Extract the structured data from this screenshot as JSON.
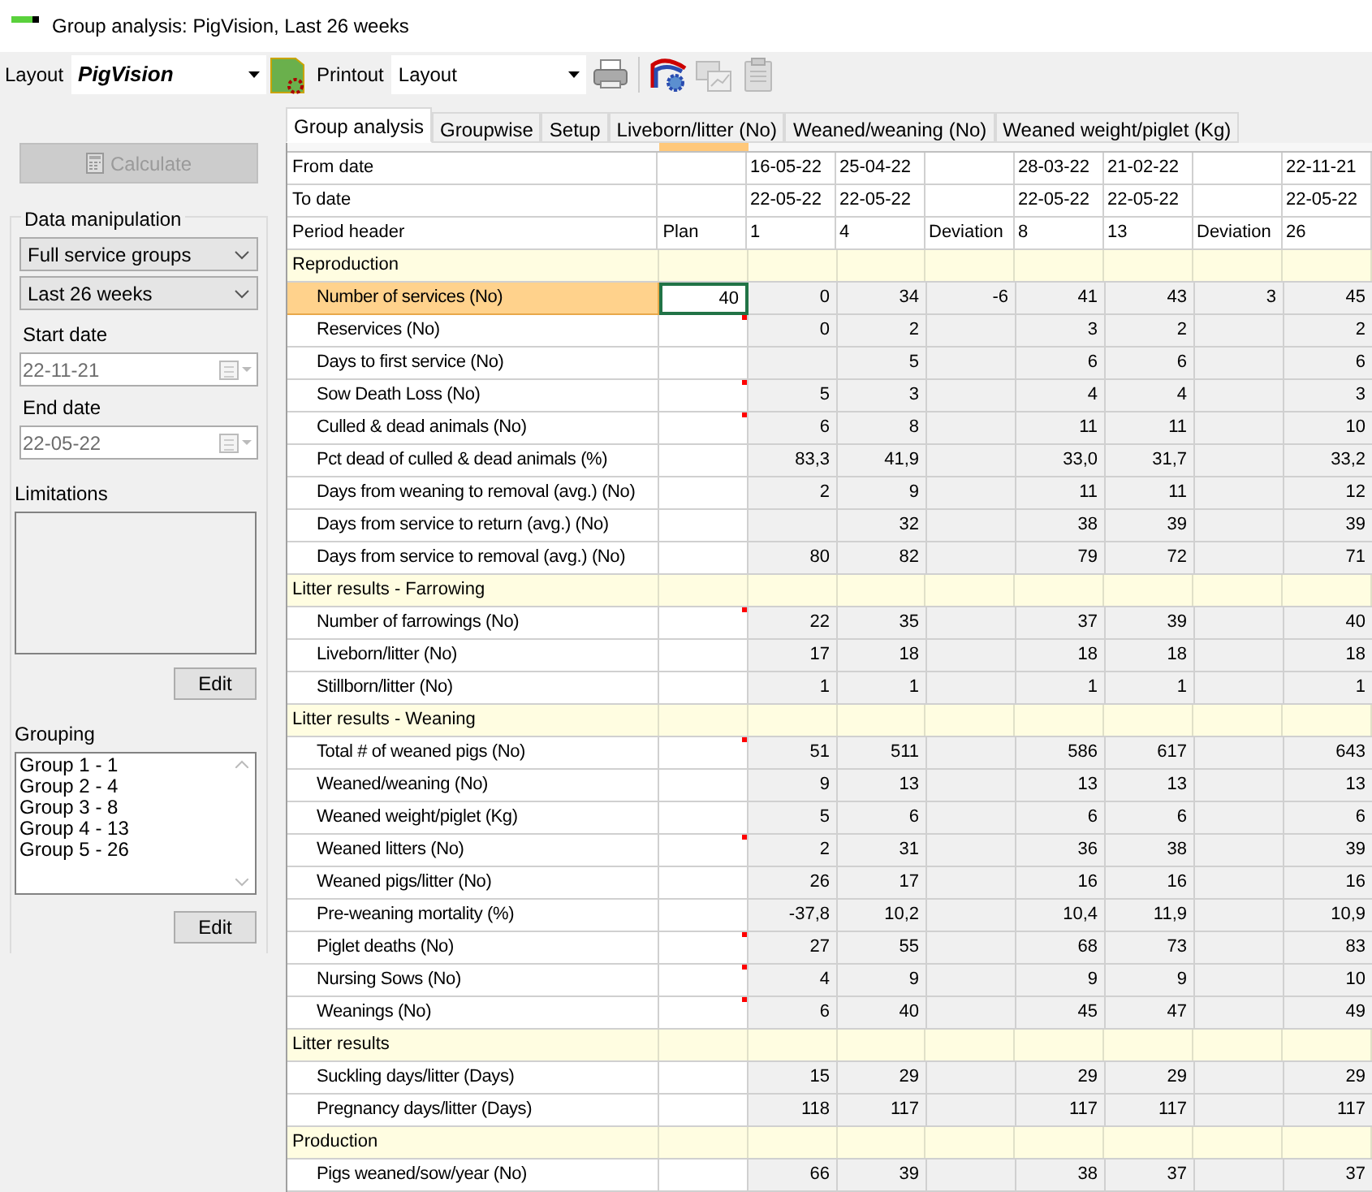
{
  "window": {
    "title": "Group analysis: PigVision, Last 26 weeks"
  },
  "toolbar": {
    "layout_label": "Layout",
    "layout_value": "PigVision",
    "printout_label": "Printout",
    "printout_value": "Layout"
  },
  "sidebar": {
    "calculate": {
      "label": "Calculate",
      "disabled": true
    },
    "data_manipulation": {
      "title": "Data manipulation",
      "selects": [
        "Full service groups",
        "Last 26 weeks"
      ],
      "start_date": {
        "label": "Start date",
        "value": "22-11-21"
      },
      "end_date": {
        "label": "End date",
        "value": "22-05-22"
      }
    },
    "limitations": {
      "label": "Limitations",
      "edit": "Edit"
    },
    "grouping": {
      "label": "Grouping",
      "items": [
        "Group 1 - 1",
        "Group 2 - 4",
        "Group 3 - 8",
        "Group 4 - 13",
        "Group 5 - 26"
      ],
      "edit": "Edit"
    }
  },
  "tabs": [
    {
      "label": "Group analysis",
      "selected": true
    },
    {
      "label": "Groupwise",
      "selected": false
    },
    {
      "label": "Setup",
      "selected": false
    },
    {
      "label": "Liveborn/litter (No)",
      "selected": false
    },
    {
      "label": "Weaned/weaning (No)",
      "selected": false
    },
    {
      "label": "Weaned weight/piglet (Kg)",
      "selected": false
    }
  ],
  "table": {
    "rows": [
      {
        "kind": "info",
        "label": "From date",
        "cells": {
          "column_1": "16-05-22",
          "column_2": "25-04-22",
          "column_4": "28-03-22",
          "column_5": "21-02-22",
          "column_7": "22-11-21"
        }
      },
      {
        "kind": "info",
        "label": "To date",
        "cells": {
          "column_1": "22-05-22",
          "column_2": "22-05-22",
          "column_4": "22-05-22",
          "column_5": "22-05-22",
          "column_7": "22-05-22"
        }
      },
      {
        "kind": "info",
        "label": "Period header",
        "plan": "Plan",
        "cells": {
          "column_1": "1",
          "column_2": "4",
          "column_3": "Deviation",
          "column_4": "8",
          "column_5": "13",
          "column_6": "Deviation",
          "column_7": "26"
        }
      },
      {
        "kind": "section",
        "label": "Reproduction"
      },
      {
        "kind": "metric",
        "label": "Number of services (No)",
        "plan": "40",
        "selected": true,
        "marked": false,
        "cells": {
          "column_1": "0",
          "column_2": "34",
          "column_3": "-6",
          "column_4": "41",
          "column_5": "43",
          "column_6": "3",
          "column_7": "45"
        }
      },
      {
        "kind": "metric",
        "label": "Reservices (No)",
        "selected": false,
        "marked": true,
        "cells": {
          "column_1": "0",
          "column_2": "2",
          "column_4": "3",
          "column_5": "2",
          "column_7": "2"
        }
      },
      {
        "kind": "metric",
        "label": "Days to first service (No)",
        "selected": false,
        "marked": false,
        "cells": {
          "column_2": "5",
          "column_4": "6",
          "column_5": "6",
          "column_7": "6"
        }
      },
      {
        "kind": "metric",
        "label": "Sow Death Loss (No)",
        "selected": false,
        "marked": true,
        "cells": {
          "column_1": "5",
          "column_2": "3",
          "column_4": "4",
          "column_5": "4",
          "column_7": "3"
        }
      },
      {
        "kind": "metric",
        "label": "Culled & dead animals (No)",
        "selected": false,
        "marked": true,
        "cells": {
          "column_1": "6",
          "column_2": "8",
          "column_4": "11",
          "column_5": "11",
          "column_7": "10"
        }
      },
      {
        "kind": "metric",
        "label": "Pct dead of culled & dead animals (%)",
        "selected": false,
        "marked": false,
        "cells": {
          "column_1": "83,3",
          "column_2": "41,9",
          "column_4": "33,0",
          "column_5": "31,7",
          "column_7": "33,2"
        }
      },
      {
        "kind": "metric",
        "label": "Days from weaning to removal (avg.) (No)",
        "selected": false,
        "marked": false,
        "cells": {
          "column_1": "2",
          "column_2": "9",
          "column_4": "11",
          "column_5": "11",
          "column_7": "12"
        }
      },
      {
        "kind": "metric",
        "label": "Days from service to return (avg.) (No)",
        "selected": false,
        "marked": false,
        "cells": {
          "column_2": "32",
          "column_4": "38",
          "column_5": "39",
          "column_7": "39"
        }
      },
      {
        "kind": "metric",
        "label": "Days from service to removal (avg.) (No)",
        "selected": false,
        "marked": false,
        "cells": {
          "column_1": "80",
          "column_2": "82",
          "column_4": "79",
          "column_5": "72",
          "column_7": "71"
        }
      },
      {
        "kind": "section",
        "label": "Litter results - Farrowing"
      },
      {
        "kind": "metric",
        "label": "Number of farrowings (No)",
        "selected": false,
        "marked": true,
        "cells": {
          "column_1": "22",
          "column_2": "35",
          "column_4": "37",
          "column_5": "39",
          "column_7": "40"
        }
      },
      {
        "kind": "metric",
        "label": "Liveborn/litter (No)",
        "selected": false,
        "marked": false,
        "cells": {
          "column_1": "17",
          "column_2": "18",
          "column_4": "18",
          "column_5": "18",
          "column_7": "18"
        }
      },
      {
        "kind": "metric",
        "label": "Stillborn/litter (No)",
        "selected": false,
        "marked": false,
        "cells": {
          "column_1": "1",
          "column_2": "1",
          "column_4": "1",
          "column_5": "1",
          "column_7": "1"
        }
      },
      {
        "kind": "section",
        "label": "Litter results - Weaning"
      },
      {
        "kind": "metric",
        "label": "Total # of weaned pigs (No)",
        "selected": false,
        "marked": true,
        "cells": {
          "column_1": "51",
          "column_2": "511",
          "column_4": "586",
          "column_5": "617",
          "column_7": "643"
        }
      },
      {
        "kind": "metric",
        "label": "Weaned/weaning (No)",
        "selected": false,
        "marked": false,
        "cells": {
          "column_1": "9",
          "column_2": "13",
          "column_4": "13",
          "column_5": "13",
          "column_7": "13"
        }
      },
      {
        "kind": "metric",
        "label": "Weaned weight/piglet (Kg)",
        "selected": false,
        "marked": false,
        "cells": {
          "column_1": "5",
          "column_2": "6",
          "column_4": "6",
          "column_5": "6",
          "column_7": "6"
        }
      },
      {
        "kind": "metric",
        "label": "Weaned litters (No)",
        "selected": false,
        "marked": true,
        "cells": {
          "column_1": "2",
          "column_2": "31",
          "column_4": "36",
          "column_5": "38",
          "column_7": "39"
        }
      },
      {
        "kind": "metric",
        "label": "Weaned pigs/litter (No)",
        "selected": false,
        "marked": false,
        "cells": {
          "column_1": "26",
          "column_2": "17",
          "column_4": "16",
          "column_5": "16",
          "column_7": "16"
        }
      },
      {
        "kind": "metric",
        "label": "Pre-weaning mortality (%)",
        "selected": false,
        "marked": false,
        "cells": {
          "column_1": "-37,8",
          "column_2": "10,2",
          "column_4": "10,4",
          "column_5": "11,9",
          "column_7": "10,9"
        }
      },
      {
        "kind": "metric",
        "label": "Piglet deaths (No)",
        "selected": false,
        "marked": true,
        "cells": {
          "column_1": "27",
          "column_2": "55",
          "column_4": "68",
          "column_5": "73",
          "column_7": "83"
        }
      },
      {
        "kind": "metric",
        "label": "Nursing Sows (No)",
        "selected": false,
        "marked": true,
        "cells": {
          "column_1": "4",
          "column_2": "9",
          "column_4": "9",
          "column_5": "9",
          "column_7": "10"
        }
      },
      {
        "kind": "metric",
        "label": "Weanings (No)",
        "selected": false,
        "marked": true,
        "cells": {
          "column_1": "6",
          "column_2": "40",
          "column_4": "45",
          "column_5": "47",
          "column_7": "49"
        }
      },
      {
        "kind": "section",
        "label": "Litter results"
      },
      {
        "kind": "metric",
        "label": "Suckling days/litter (Days)",
        "selected": false,
        "marked": false,
        "cells": {
          "column_1": "15",
          "column_2": "29",
          "column_4": "29",
          "column_5": "29",
          "column_7": "29"
        }
      },
      {
        "kind": "metric",
        "label": "Pregnancy days/litter (Days)",
        "selected": false,
        "marked": false,
        "cells": {
          "column_1": "118",
          "column_2": "117",
          "column_4": "117",
          "column_5": "117",
          "column_7": "117"
        }
      },
      {
        "kind": "section",
        "label": "Production"
      },
      {
        "kind": "metric",
        "label": "Pigs weaned/sow/year (No)",
        "selected": false,
        "marked": false,
        "cells": {
          "column_1": "66",
          "column_2": "39",
          "column_4": "38",
          "column_5": "37",
          "column_7": "37"
        }
      }
    ]
  }
}
